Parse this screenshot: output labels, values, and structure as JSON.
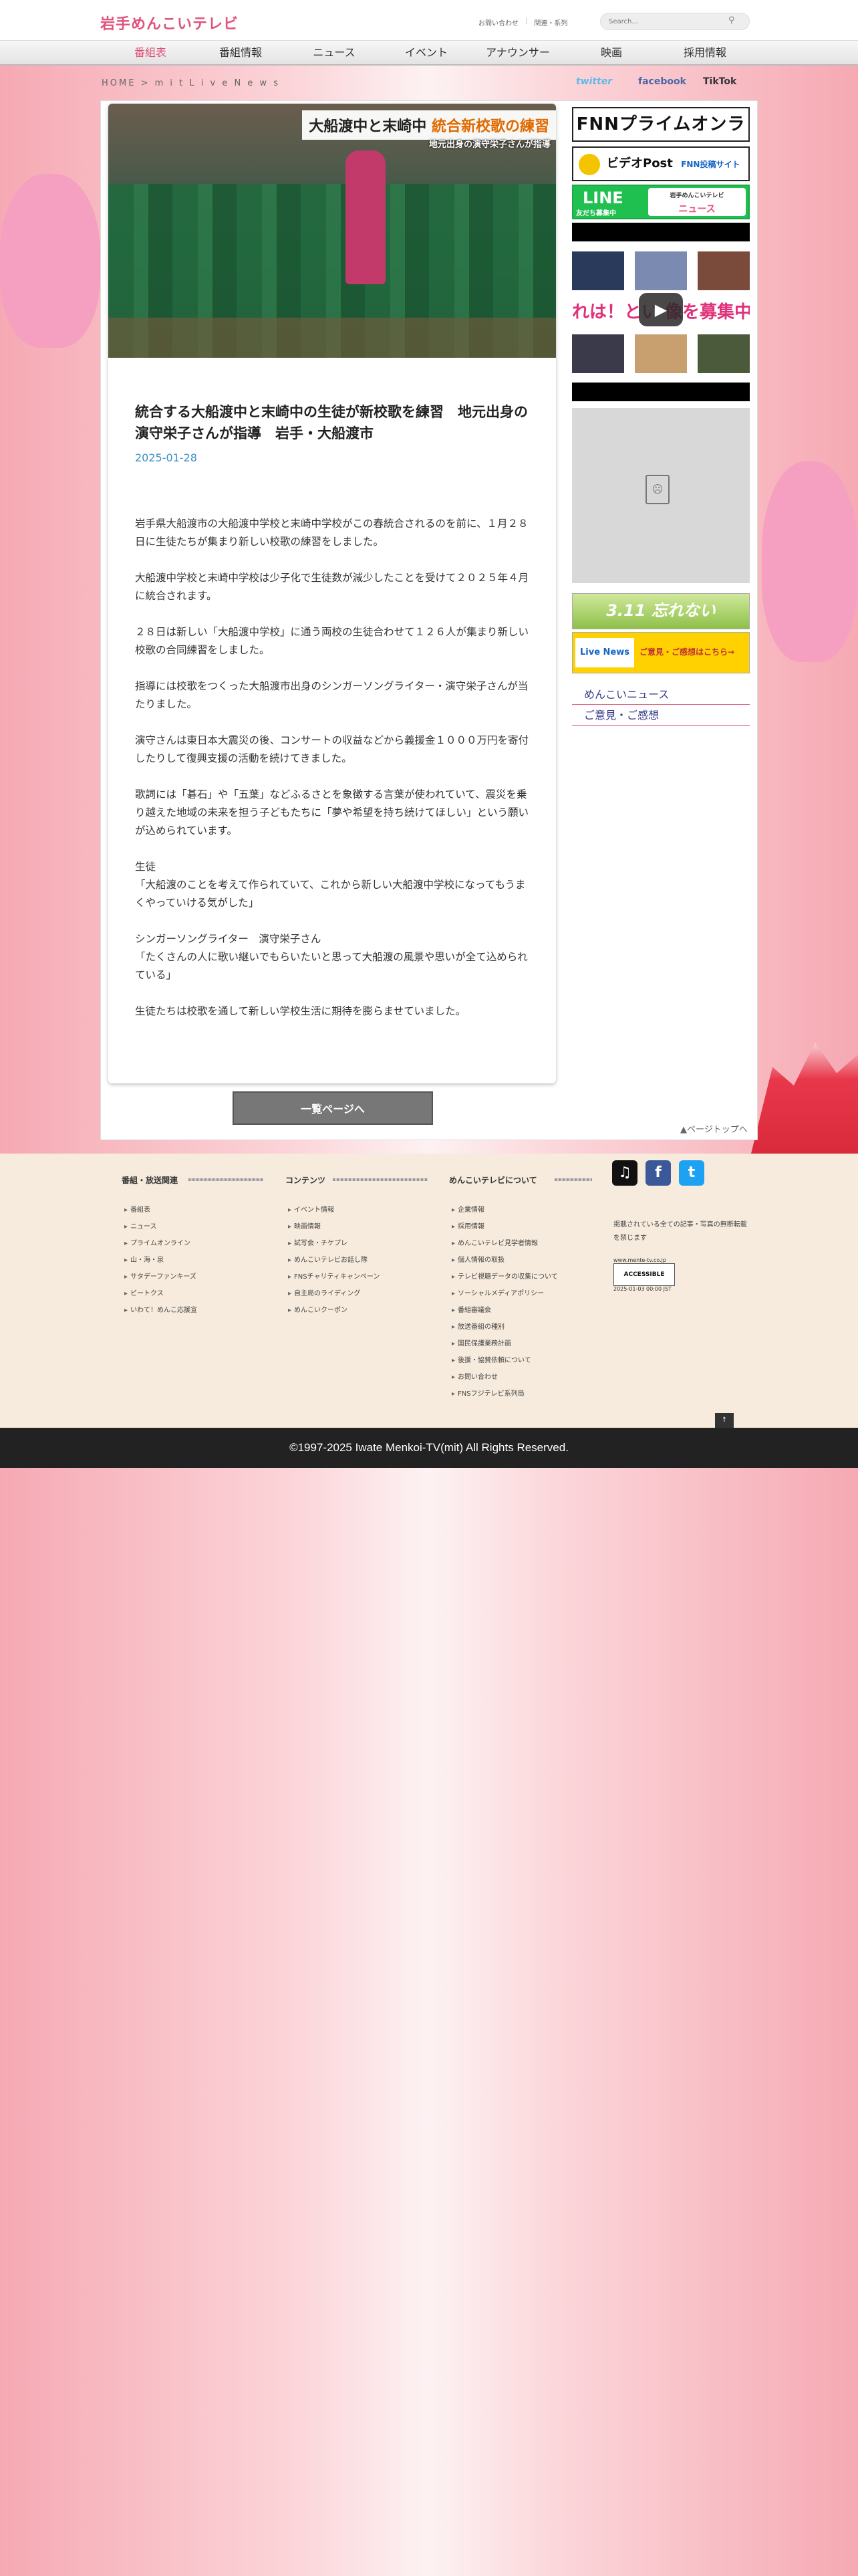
{
  "header": {
    "logo": "岩手めんこいテレビ",
    "links": [
      "お問い合わせ",
      "関連・系列"
    ],
    "search_placeholder": "Search..."
  },
  "nav": [
    "番組表",
    "番組情報",
    "ニュース",
    "イベント",
    "アナウンサー",
    "映画",
    "採用情報"
  ],
  "breadcrumb": "HOME > m i t   L i v e   N e w s",
  "sns": {
    "twitter": "twitter",
    "facebook": "facebook",
    "tiktok": "TikTok"
  },
  "video": {
    "caption_a": "大船渡中と末崎中",
    "caption_b": "統合新校歌の練習",
    "sub": "地元出身の演守栄子さんが指導"
  },
  "article": {
    "title": "統合する大船渡中と末崎中の生徒が新校歌を練習　地元出身の演守栄子さんが指導　岩手・大船渡市",
    "date": "2025-01-28",
    "paragraphs": [
      "岩手県大船渡市の大船渡中学校と末崎中学校がこの春統合されるのを前に、１月２８日に生徒たちが集まり新しい校歌の練習をしました。",
      "大船渡中学校と末崎中学校は少子化で生徒数が減少したことを受けて２０２５年４月に統合されます。",
      "２８日は新しい「大船渡中学校」に通う両校の生徒合わせて１２６人が集まり新しい校歌の合同練習をしました。",
      "指導には校歌をつくった大船渡市出身のシンガーソングライター・演守栄子さんが当たりました。",
      "演守さんは東日本大震災の後、コンサートの収益などから義援金１０００万円を寄付したりして復興支援の活動を続けてきました。",
      "歌詞には「碁石」や「五葉」などふるさとを象徴する言葉が使われていて、震災を乗り越えた地域の未来を担う子どもたちに「夢や希望を持ち続けてほしい」という願いが込められています。",
      "生徒\n「大船渡のことを考えて作られていて、これから新しい大船渡中学校になってもうまくやっていける気がした」",
      "シンガーソングライター　演守栄子さん\n「たくさんの人に歌い継いでもらいたいと思って大船渡の風景や思いが全て込められている」",
      "生徒たちは校歌を通して新しい学校生活に期待を膨らませていました。"
    ]
  },
  "back_button": "一覧ページへ",
  "page_top": "▲ページトップへ",
  "sidebar": {
    "fnn": "FNNプライムオンライン",
    "videopost": "ビデオPost",
    "videopost_sub": "FNN投稿サイト",
    "line_top": "LINE",
    "line_bottom": "友だち募集中",
    "line_right_a": "岩手めんこいテレビ",
    "line_right_b": "ニュース",
    "recruit_band": "れは！とい 像を募集中",
    "b311": "3.11 忘れない",
    "livenews_left": "Live News",
    "livenews_right": "ご意見・ご感想はこちら→",
    "links": [
      "めんこいニュース",
      "ご意見・ご感想"
    ]
  },
  "footer": {
    "col1_title": "番組・放送関連",
    "col1": [
      "番組表",
      "ニュース",
      "プライムオンライン",
      "山・海・泉",
      "サタデーファンキーズ",
      "ビートクス",
      "いわて！めんこ応援宣"
    ],
    "col2_title": "コンテンツ",
    "col2": [
      "イベント情報",
      "映画情報",
      "試写会・チケプレ",
      "めんこいテレビお話し隊",
      "FNSチャリティキャンペーン",
      "自主局のライディング",
      "めんこいクーポン"
    ],
    "col3_title": "めんこいテレビについて",
    "col3": [
      "企業情報",
      "採用情報",
      "めんこいテレビ見学者情報",
      "個人情報の取扱",
      "テレビ視聴データの収集について",
      "ソーシャルメディアポリシー",
      "番組審議会",
      "放送番組の種別",
      "国民保護業務計画",
      "後援・協賛依頼について",
      "お問い合わせ",
      "FNSフジテレビ系列局"
    ],
    "note": "掲載されている全ての記事・写真の無断転載を禁じます",
    "badge_url": "www.mente-tv.co.jp",
    "badge_label": "ACCESSIBLE",
    "badge_date": "2025-01-03 00:00 JST"
  },
  "copyright": "©1997-2025 Iwate Menkoi-TV(mit) All Rights Reserved."
}
